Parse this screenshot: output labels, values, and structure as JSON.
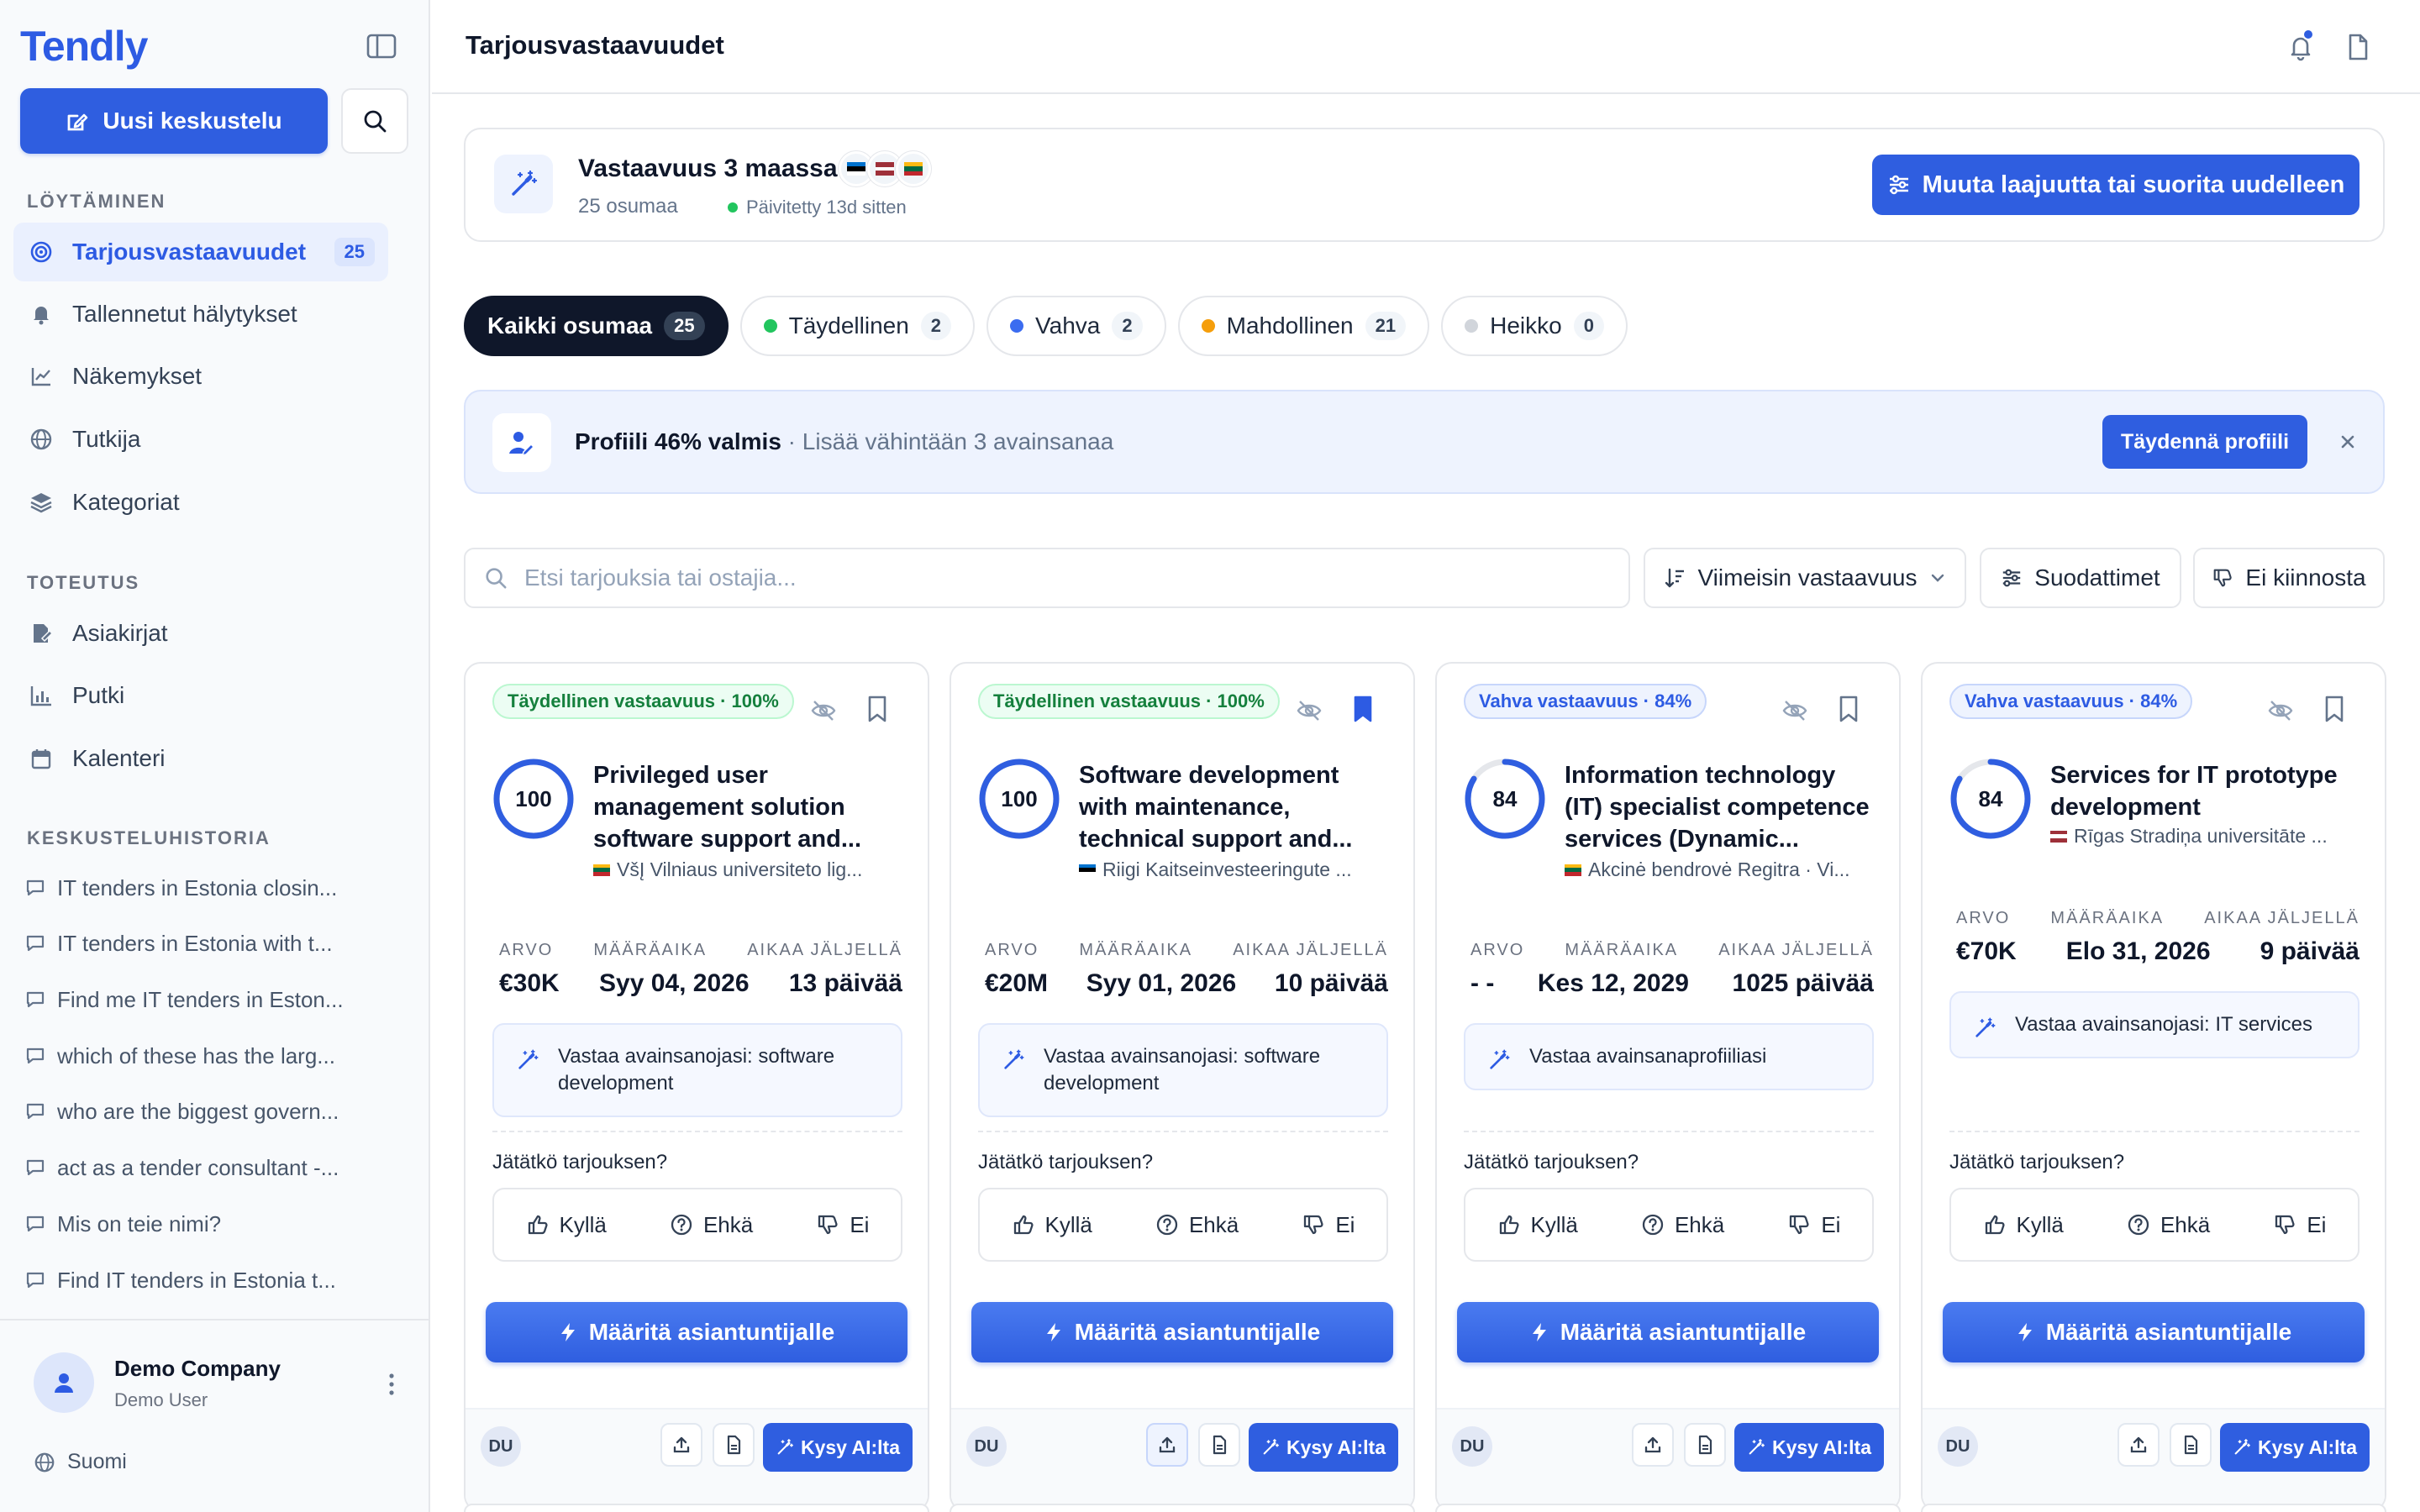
{
  "app": {
    "logo": "Tendly",
    "new_chat": "Uusi keskustelu",
    "sections": {
      "discover": "LÖYTÄMINEN",
      "execute": "TOTEUTUS",
      "history": "KESKUSTELUHISTORIA"
    },
    "discover_items": [
      {
        "label": "Tarjousvastaavuudet",
        "badge": "25"
      },
      {
        "label": "Tallennetut hälytykset"
      },
      {
        "label": "Näkemykset"
      },
      {
        "label": "Tutkija"
      },
      {
        "label": "Kategoriat"
      }
    ],
    "execute_items": [
      {
        "label": "Asiakirjat"
      },
      {
        "label": "Putki"
      },
      {
        "label": "Kalenteri"
      }
    ],
    "history": [
      "IT tenders in Estonia closin...",
      "IT tenders in Estonia with t...",
      "Find me IT tenders in Eston...",
      "which of these has the larg...",
      "who are the biggest govern...",
      "act as a tender consultant -...",
      "Mis on teie nimi?",
      "Find IT tenders in Estonia t..."
    ],
    "company": "Demo Company",
    "user": "Demo User",
    "language": "Suomi"
  },
  "header": {
    "title": "Tarjousvastaavuudet"
  },
  "summary": {
    "title": "Vastaavuus 3 maassa",
    "matches": "25 osumaa",
    "updated": "Päivitetty 13d sitten",
    "rerun": "Muuta laajuutta tai suorita uudelleen",
    "colors": {
      "estonia": [
        "#0072ce",
        "#000000",
        "#ffffff"
      ],
      "latvia": [
        "#9e3039",
        "#ffffff",
        "#9e3039"
      ],
      "lithuania": [
        "#fdb913",
        "#006a44",
        "#c1272d"
      ]
    }
  },
  "tabs": [
    {
      "label": "Kaikki osumaa",
      "count": "25",
      "color": ""
    },
    {
      "label": "Täydellinen",
      "count": "2",
      "color": "#22c55e"
    },
    {
      "label": "Vahva",
      "count": "2",
      "color": "#3b6cf0"
    },
    {
      "label": "Mahdollinen",
      "count": "21",
      "color": "#f59e0b"
    },
    {
      "label": "Heikko",
      "count": "0",
      "color": "#d1d5db"
    }
  ],
  "banner": {
    "title": "Profiili 46% valmis",
    "subtitle": " · Lisää vähintään 3 avainsanaa",
    "button": "Täydennä profiili"
  },
  "filters": {
    "search_placeholder": "Etsi tarjouksia tai ostajia...",
    "sort": "Viimeisin vastaavuus",
    "filters": "Suodattimet",
    "not_interested": "Ei kiinnosta"
  },
  "labels": {
    "value": "ARVO",
    "deadline": "MÄÄRÄAIKA",
    "time_left": "AIKAA JÄLJELLÄ",
    "bid_question": "Jätätkö tarjouksen?",
    "yes": "Kyllä",
    "maybe": "Ehkä",
    "no": "Ei",
    "assign": "Määritä asiantuntijalle",
    "ask_ai": "Kysy AI:lta",
    "initials": "DU"
  },
  "cards": [
    {
      "badge": "Täydellinen vastaavuus · 100%",
      "badge_type": "perfect",
      "score": 100,
      "title": "Privileged user management solution software support and...",
      "flag": "lithuania",
      "buyer": "VšĮ Vilniaus universiteto lig...",
      "value": "€30K",
      "deadline": "Syy 04, 2026",
      "time_left": "13 päivää",
      "keywords": "Vastaa avainsanojasi: software development",
      "saved": false
    },
    {
      "badge": "Täydellinen vastaavuus · 100%",
      "badge_type": "perfect",
      "score": 100,
      "title": "Software development with maintenance, technical support and...",
      "flag": "estonia",
      "buyer": "Riigi Kaitseinvesteeringute ...",
      "value": "€20M",
      "deadline": "Syy 01, 2026",
      "time_left": "10 päivää",
      "keywords": "Vastaa avainsanojasi: software development",
      "saved": true
    },
    {
      "badge": "Vahva vastaavuus · 84%",
      "badge_type": "strong",
      "score": 84,
      "title": "Information technology (IT) specialist competence services (Dynamic...",
      "flag": "lithuania",
      "buyer": "Akcinė bendrovė Regitra · Vi...",
      "value": "- -",
      "deadline": "Kes 12, 2029",
      "time_left": "1025 päivää",
      "keywords": "Vastaa avainsanaprofiiliasi",
      "saved": false
    },
    {
      "badge": "Vahva vastaavuus · 84%",
      "badge_type": "strong",
      "score": 84,
      "title": "Services for IT prototype development",
      "flag": "latvia",
      "buyer": "Rīgas Stradiņa universitāte ...",
      "value": "€70K",
      "deadline": "Elo 31, 2026",
      "time_left": "9 päivää",
      "keywords": "Vastaa avainsanojasi: IT services",
      "saved": false
    }
  ]
}
